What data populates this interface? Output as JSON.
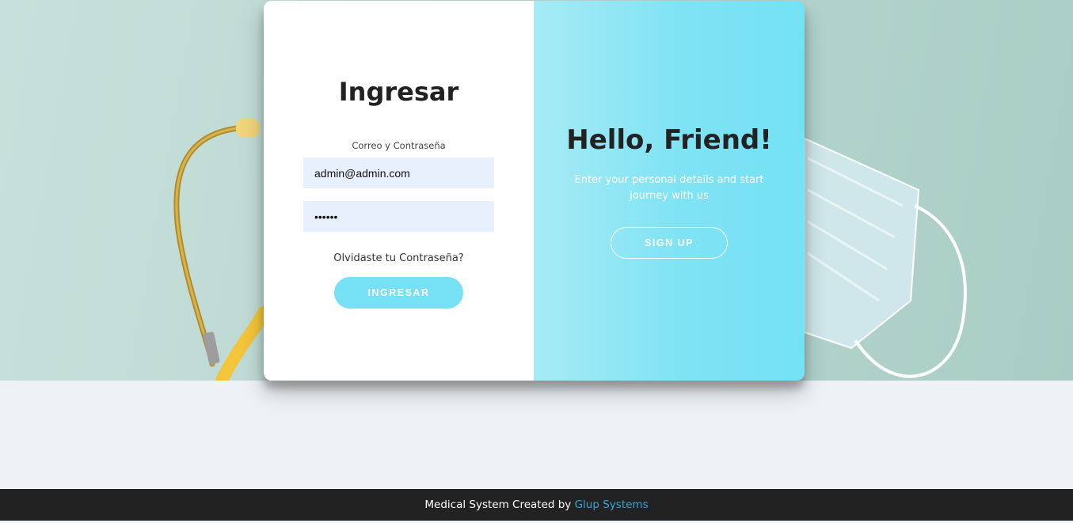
{
  "login": {
    "title": "Ingresar",
    "subtitle": "Correo y Contraseña",
    "email_value": "admin@admin.com",
    "password_value": "••••••",
    "forgot_link": "Olvidaste tu Contraseña?",
    "submit_label": "INGRESAR"
  },
  "overlay": {
    "title": "Hello, Friend!",
    "text": "Enter your personal details and start journey with us",
    "signup_label": "SIGN UP"
  },
  "footer": {
    "text": "Medical System Created by ",
    "link": "Glup Systems"
  },
  "colors": {
    "accent": "#76e0f4",
    "footer_bg": "#222222",
    "link": "#3aa5d6"
  }
}
